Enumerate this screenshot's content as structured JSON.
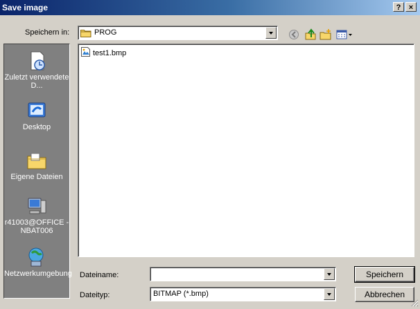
{
  "window": {
    "title": "Save image",
    "help": "?",
    "close": "×"
  },
  "lookin": {
    "label": "Speichern in:",
    "value": "PROG"
  },
  "places": [
    {
      "label": "Zuletzt verwendete D..."
    },
    {
      "label": "Desktop"
    },
    {
      "label": "Eigene Dateien"
    },
    {
      "label": "r41003@OFFICE - NBAT006"
    },
    {
      "label": "Netzwerkumgebung"
    }
  ],
  "files": [
    {
      "name": "test1.bmp"
    }
  ],
  "filename": {
    "label": "Dateiname:",
    "value": ""
  },
  "filetype": {
    "label": "Dateityp:",
    "value": "BITMAP (*.bmp)"
  },
  "buttons": {
    "save": "Speichern",
    "cancel": "Abbrechen"
  },
  "icons": {
    "folder": "folder-icon",
    "back": "back-icon",
    "up": "up-folder-icon",
    "new_folder": "new-folder-icon",
    "views": "views-menu-icon",
    "recent": "recent-documents-icon",
    "desktop": "desktop-icon",
    "documents": "my-documents-icon",
    "computer": "my-computer-icon",
    "network": "network-icon",
    "bmp": "bmp-file-icon"
  }
}
